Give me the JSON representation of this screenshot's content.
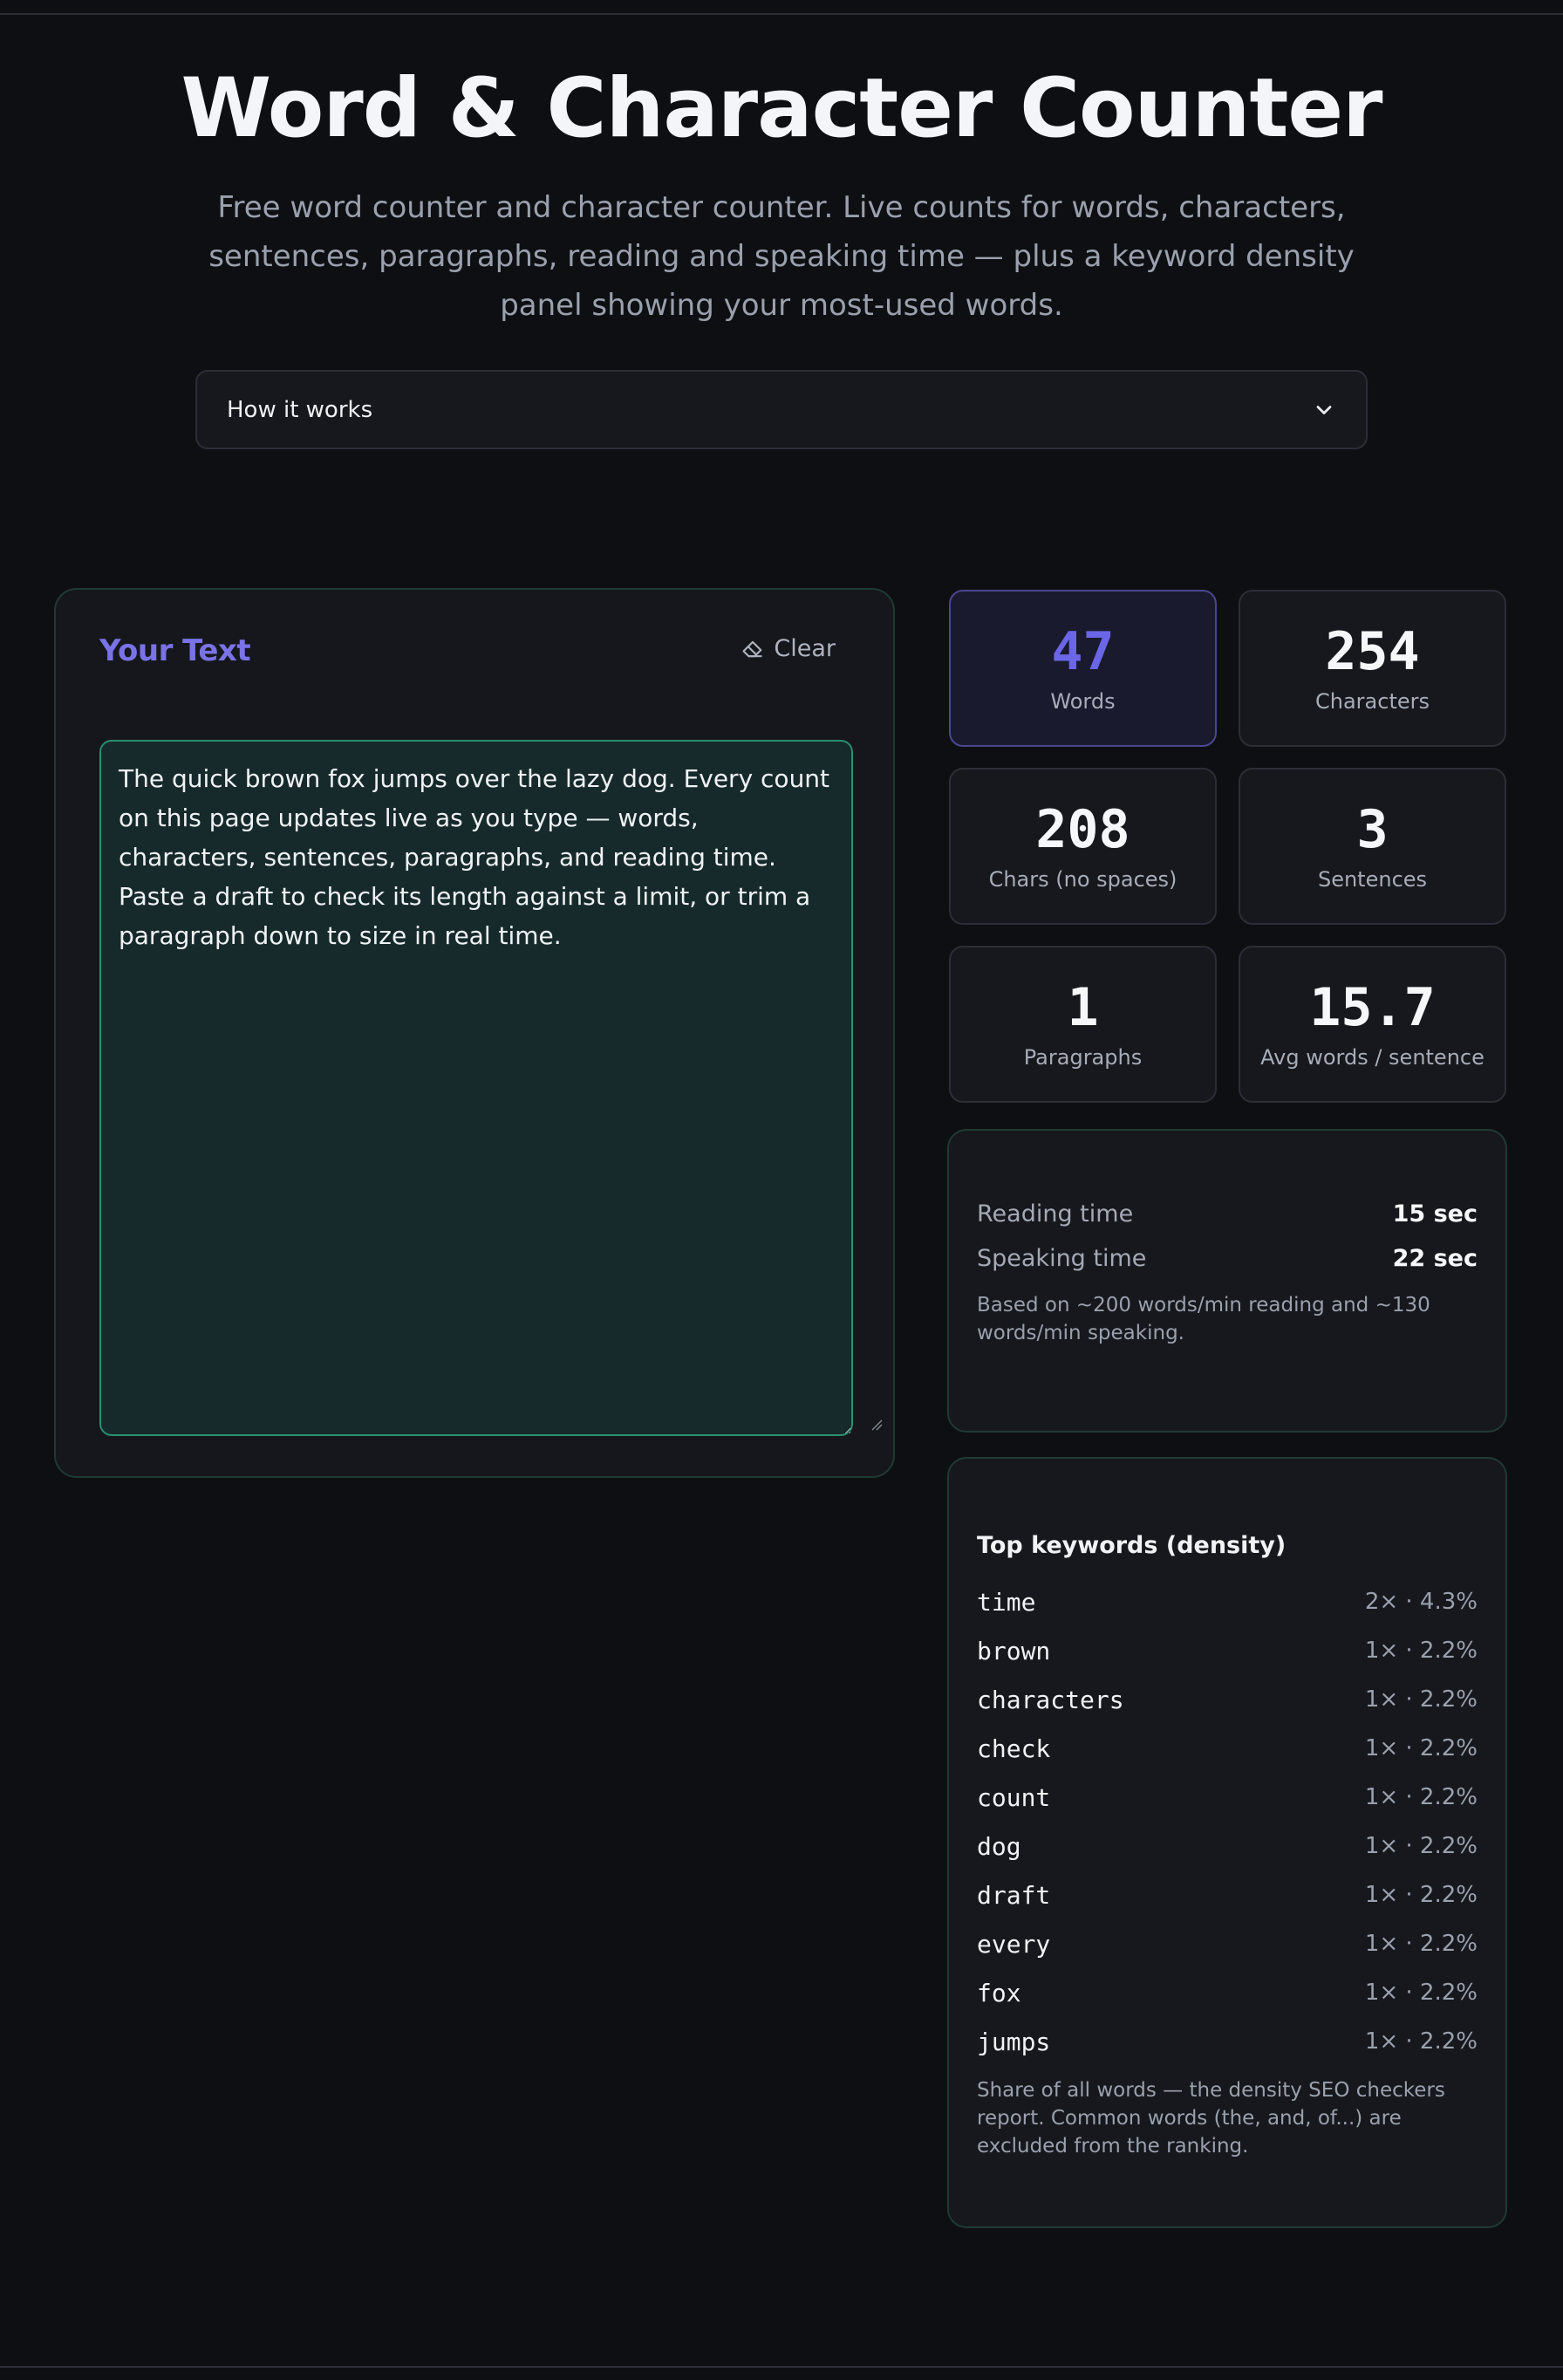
{
  "page": {
    "title": "Word & Character Counter",
    "subtitle": "Free word counter and character counter. Live counts for words, characters, sentences, paragraphs, reading and speaking time — plus a keyword density panel showing your most-used words."
  },
  "accordion": {
    "label": "How it works",
    "icon": "chevron-down-icon"
  },
  "editor": {
    "title": "Your Text",
    "clear_label": "Clear",
    "clear_icon": "eraser-icon",
    "text": "The quick brown fox jumps over the lazy dog. Every count on this page updates live as you type — words, characters, sentences, paragraphs, and reading time. Paste a draft to check its length against a limit, or trim a paragraph down to size in real time."
  },
  "stats": [
    {
      "value": "47",
      "label": "Words",
      "active": true
    },
    {
      "value": "254",
      "label": "Characters"
    },
    {
      "value": "208",
      "label": "Chars (no spaces)"
    },
    {
      "value": "3",
      "label": "Sentences"
    },
    {
      "value": "1",
      "label": "Paragraphs"
    },
    {
      "value": "15.7",
      "label": "Avg words / sentence"
    }
  ],
  "timing": {
    "reading_label": "Reading time",
    "reading_value": "15 sec",
    "speaking_label": "Speaking time",
    "speaking_value": "22 sec",
    "note": "Based on ~200 words/min reading and ~130 words/min speaking."
  },
  "keywords": {
    "title": "Top keywords (density)",
    "items": [
      {
        "word": "time",
        "value": "2× · 4.3%"
      },
      {
        "word": "brown",
        "value": "1× · 2.2%"
      },
      {
        "word": "characters",
        "value": "1× · 2.2%"
      },
      {
        "word": "check",
        "value": "1× · 2.2%"
      },
      {
        "word": "count",
        "value": "1× · 2.2%"
      },
      {
        "word": "dog",
        "value": "1× · 2.2%"
      },
      {
        "word": "draft",
        "value": "1× · 2.2%"
      },
      {
        "word": "every",
        "value": "1× · 2.2%"
      },
      {
        "word": "fox",
        "value": "1× · 2.2%"
      },
      {
        "word": "jumps",
        "value": "1× · 2.2%"
      }
    ],
    "note": "Share of all words — the density SEO checkers report. Common words (the, and, of...) are excluded from the ranking."
  },
  "colors": {
    "background": "#0e0f13",
    "accent": "#6b66e8",
    "editor_border": "#2a8f6f"
  }
}
